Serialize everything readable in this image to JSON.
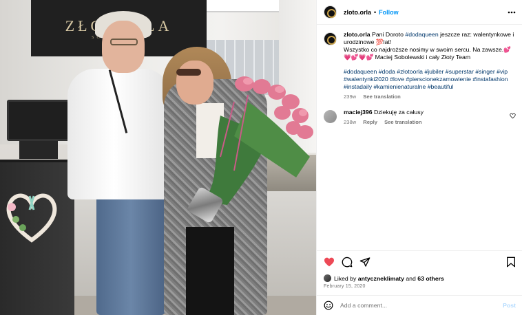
{
  "photo": {
    "sign_logo": "ZŁOTORLA",
    "sign_sub": "SOBOLEWSKI"
  },
  "header": {
    "username": "zloto.orla",
    "separator": "•",
    "follow_label": "Follow",
    "more_icon": "more-horizontal-icon"
  },
  "caption": {
    "username": "zloto.orla",
    "text_1": "Pani Doroto",
    "tag_1": "#dodaqueen",
    "text_2": "jeszcze raz: walentynkowe i urodzinowe 💯lat!",
    "line_2": "Wszystko co najdroższe nosimy w swoim sercu. Na zawsze.💕💗💕💗💕 Maciej Sobolewski i cały Złoty Team",
    "hashtags": "#dodaqueen #doda #złotoorla #jubiler #superstar #singer #vip #walentynki2020 #love #pierscionekzamowienie #instafashion #instadaily #kamienienaturalne #beautiful",
    "age": "239w",
    "see_translation": "See translation"
  },
  "comment": {
    "username": "maciej396",
    "text": "Dziekuję za całusy",
    "age": "238w",
    "reply": "Reply",
    "see_translation": "See translation",
    "like_icon": "heart-outline-icon"
  },
  "actions": {
    "like_icon": "heart-filled-icon",
    "like_color": "#ed4956",
    "comment_icon": "comment-icon",
    "share_icon": "send-icon",
    "save_icon": "bookmark-icon"
  },
  "likes": {
    "prefix": "Liked by",
    "user": "antyczneklimaty",
    "and": "and",
    "others": "63 others"
  },
  "date": "February 15, 2020",
  "add_comment": {
    "emoji_icon": "emoji-icon",
    "placeholder": "Add a comment...",
    "post_label": "Post"
  },
  "colors": {
    "accent": "#0095f6",
    "hashtag": "#00376b",
    "muted": "#737373",
    "post_disabled": "#b3dbff"
  }
}
